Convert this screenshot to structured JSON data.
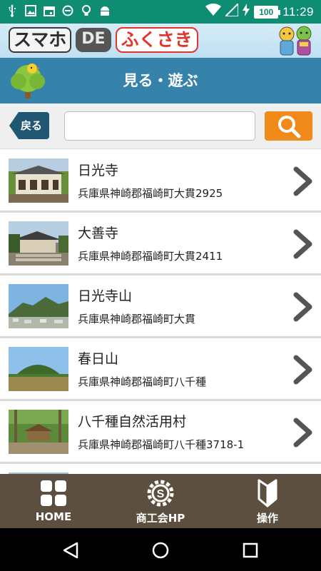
{
  "status_bar": {
    "time": "11:29",
    "battery": "100",
    "left_icons": [
      "usb-icon",
      "image-icon",
      "calendar-icon",
      "dnd-icon",
      "bulb-icon",
      "android-icon"
    ],
    "right_icons": [
      "wifi-icon",
      "signal-icon",
      "charging-icon"
    ]
  },
  "banner": {
    "logo_part1": "スマホ",
    "logo_part2": "DE",
    "logo_part3": "ふくさき"
  },
  "header": {
    "title": "見る・遊ぶ"
  },
  "search": {
    "back_label": "戻る",
    "value": "",
    "placeholder": "",
    "button_icon": "search-icon"
  },
  "places": [
    {
      "name": "日光寺",
      "address": "兵庫県神崎郡福崎町大貫2925"
    },
    {
      "name": "大善寺",
      "address": "兵庫県神崎郡福崎町大貫2411"
    },
    {
      "name": "日光寺山",
      "address": "兵庫県神崎郡福崎町大貫"
    },
    {
      "name": "春日山",
      "address": "兵庫県神崎郡福崎町八千種"
    },
    {
      "name": "八千種自然活用村",
      "address": "兵庫県神崎郡福崎町八千種3718-1"
    }
  ],
  "bottom_nav": [
    {
      "label": "HOME",
      "icon": "grid-icon"
    },
    {
      "label": "商工会HP",
      "icon": "gear-icon"
    },
    {
      "label": "操作",
      "icon": "beginner-mark-icon"
    }
  ],
  "system_nav": [
    "back-triangle-icon",
    "home-circle-icon",
    "recents-square-icon"
  ],
  "colors": {
    "status_bar": "#0f8d73",
    "title_bar": "#3582ab",
    "search_button": "#f08a1a",
    "bottom_nav": "#5c4f3f",
    "back_button": "#1f5672"
  }
}
